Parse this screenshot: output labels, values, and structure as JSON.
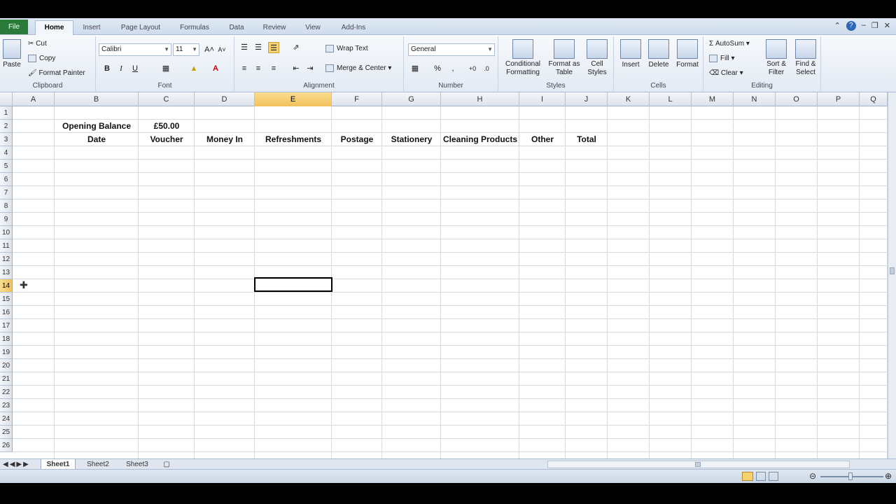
{
  "ribbon_tabs": [
    "File",
    "Home",
    "Insert",
    "Page Layout",
    "Formulas",
    "Data",
    "Review",
    "View",
    "Add-Ins"
  ],
  "clipboard": {
    "paste": "Paste",
    "cut": "Cut",
    "copy": "Copy",
    "format_painter": "Format Painter",
    "label": "Clipboard"
  },
  "font": {
    "name": "Calibri",
    "size": "11",
    "bold": "B",
    "italic": "I",
    "underline": "U",
    "label": "Font"
  },
  "alignment": {
    "wrap_text": "Wrap Text",
    "merge_center": "Merge & Center",
    "label": "Alignment"
  },
  "number": {
    "format": "General",
    "percent": "%",
    "label": "Number"
  },
  "styles": {
    "conditional": "Conditional Formatting",
    "format_table": "Format as Table",
    "cell_styles": "Cell Styles",
    "label": "Styles"
  },
  "cells_group": {
    "insert": "Insert",
    "delete": "Delete",
    "format": "Format",
    "label": "Cells"
  },
  "editing": {
    "autosum": "AutoSum",
    "fill": "Fill",
    "clear": "Clear",
    "sort": "Sort & Filter",
    "find": "Find & Select",
    "label": "Editing"
  },
  "columns": [
    "A",
    "B",
    "C",
    "D",
    "E",
    "F",
    "G",
    "H",
    "I",
    "J",
    "K",
    "L",
    "M",
    "N",
    "O",
    "P",
    "Q"
  ],
  "rows": [
    "1",
    "2",
    "3",
    "4",
    "5",
    "6",
    "7",
    "8",
    "9",
    "10",
    "11",
    "12",
    "13",
    "14",
    "15",
    "16",
    "17",
    "18",
    "19",
    "20",
    "21",
    "22",
    "23",
    "24",
    "25",
    "26"
  ],
  "selected": {
    "column": "E",
    "row": "14"
  },
  "sheet": {
    "opening_balance_label": "Opening Balance",
    "opening_balance_value": "£50.00",
    "headers": [
      "Date",
      "Voucher",
      "Money In",
      "Refreshments",
      "Postage",
      "Stationery",
      "Cleaning Products",
      "Other",
      "Total"
    ]
  },
  "sheet_tabs": [
    "Sheet1",
    "Sheet2",
    "Sheet3"
  ],
  "colors": {
    "accent": "#f1c15b",
    "file_tab": "#2a7a3a",
    "ribbon_bg": "#e3eaf4"
  }
}
